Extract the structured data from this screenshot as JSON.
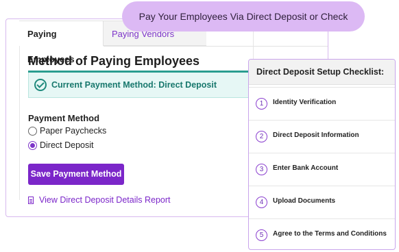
{
  "banner": {
    "text": "Pay Your Employees Via Direct Deposit or Check"
  },
  "tabs": [
    {
      "label": "Paying Employees"
    },
    {
      "label": "Paying Vendors"
    }
  ],
  "main": {
    "title": "Method of Paying Employees",
    "status": "Current Payment Method: Direct Deposit",
    "payment_method_label": "Payment Method",
    "options": [
      {
        "label": "Paper Paychecks",
        "selected": false
      },
      {
        "label": "Direct Deposit",
        "selected": true
      }
    ],
    "save_button": "Save Payment Method",
    "report_link": "View Direct Deposit Details Report"
  },
  "checklist": {
    "title": "Direct Deposit Setup Checklist:",
    "items": [
      {
        "num": "1",
        "label": "Identity Verification"
      },
      {
        "num": "2",
        "label": "Direct Deposit Information"
      },
      {
        "num": "3",
        "label": "Enter Bank Account"
      },
      {
        "num": "4",
        "label": "Upload Documents"
      },
      {
        "num": "5",
        "label": "Agree to the Terms and Conditions"
      }
    ]
  },
  "colors": {
    "accent": "#7b26c9",
    "teal": "#18786d",
    "banner": "#dcb9f4"
  },
  "icons": {
    "status": "check-circle-icon",
    "report": "document-icon"
  }
}
